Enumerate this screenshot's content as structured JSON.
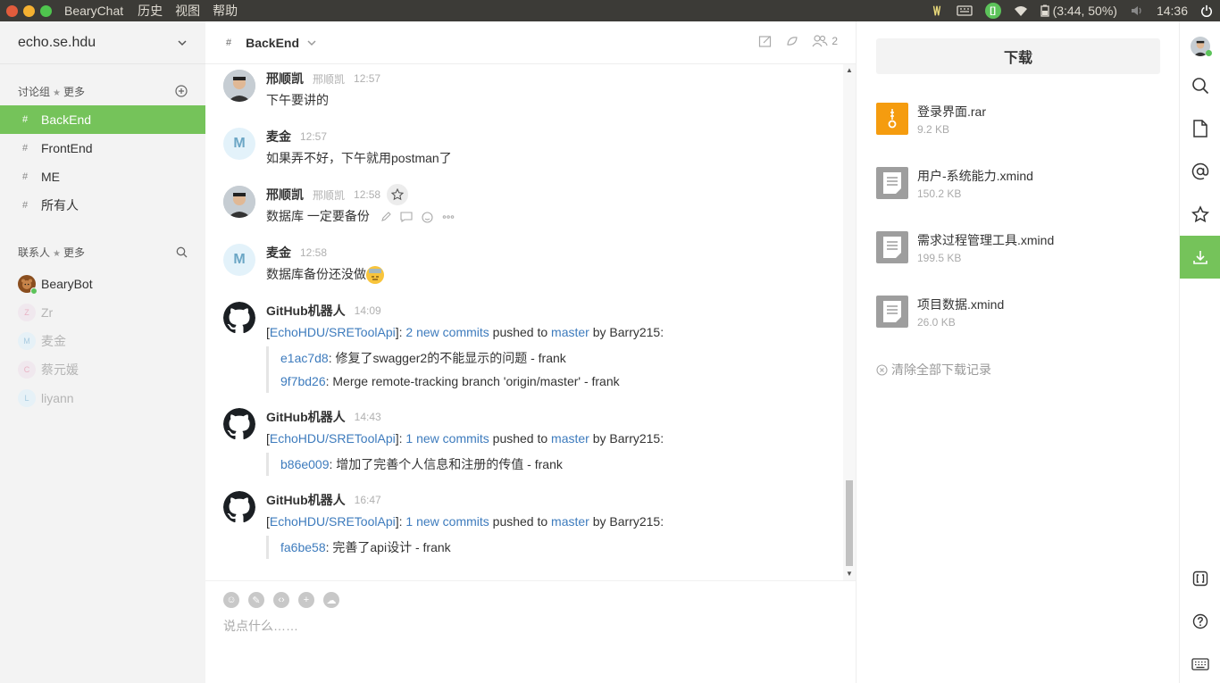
{
  "topbar": {
    "app_name": "BearyChat",
    "menu": [
      "历史",
      "视图",
      "帮助"
    ],
    "battery": "(3:44, 50%)",
    "clock": "14:36"
  },
  "sidebar": {
    "team_name": "echo.se.hdu",
    "channels_heading": "讨论组",
    "channels_more": "更多",
    "channels": [
      {
        "name": "BackEnd",
        "active": true
      },
      {
        "name": "FrontEnd",
        "active": false
      },
      {
        "name": "ME",
        "active": false
      },
      {
        "name": "所有人",
        "active": false
      }
    ],
    "contacts_heading": "联系人",
    "contacts_more": "更多",
    "contacts": [
      {
        "name": "BearyBot",
        "initial": "",
        "online": true
      },
      {
        "name": "Zr",
        "initial": "Z",
        "online": false
      },
      {
        "name": "麦金",
        "initial": "M",
        "online": false
      },
      {
        "name": "蔡元媛",
        "initial": "C",
        "online": false
      },
      {
        "name": "liyann",
        "initial": "L",
        "online": false
      }
    ]
  },
  "chat": {
    "channel_name": "BackEnd",
    "member_count": "2",
    "messages": [
      {
        "name": "邢顺凯",
        "alias": "邢顺凯",
        "time": "12:57",
        "text": "下午要讲的"
      },
      {
        "name": "麦金",
        "time": "12:57",
        "text": "如果弄不好，下午就用postman了"
      },
      {
        "name": "邢顺凯",
        "alias": "邢顺凯",
        "time": "12:58",
        "text": "数据库 一定要备份"
      },
      {
        "name": "麦金",
        "time": "12:58",
        "text": "数据库备份还没做"
      },
      {
        "name": "GitHub机器人",
        "time": "14:09",
        "repo": "EchoHDU/SREToolApi",
        "commits": "2 new commits",
        "pushed": " pushed to ",
        "branch": "master",
        "by": " by Barry215:",
        "items": [
          {
            "sha": "e1ac7d8",
            "msg": ": 修复了swagger2的不能显示的问题 - frank"
          },
          {
            "sha": "9f7bd26",
            "msg": ": Merge remote-tracking branch 'origin/master' - frank"
          }
        ]
      },
      {
        "name": "GitHub机器人",
        "time": "14:43",
        "repo": "EchoHDU/SREToolApi",
        "commits": "1 new commits",
        "pushed": " pushed to ",
        "branch": "master",
        "by": " by Barry215:",
        "items": [
          {
            "sha": "b86e009",
            "msg": ": 增加了完善个人信息和注册的传值 - frank"
          }
        ]
      },
      {
        "name": "GitHub机器人",
        "time": "16:47",
        "repo": "EchoHDU/SREToolApi",
        "commits": "1 new commits",
        "pushed": " pushed to ",
        "branch": "master",
        "by": " by Barry215:",
        "items": [
          {
            "sha": "fa6be58",
            "msg": ": 完善了api设计 - frank"
          }
        ]
      }
    ],
    "composer_placeholder": "说点什么……"
  },
  "downloads": {
    "title": "下载",
    "files": [
      {
        "name": "登录界面.rar",
        "size": "9.2 KB",
        "type": "zip"
      },
      {
        "name": "用户-系统能力.xmind",
        "size": "150.2 KB",
        "type": "doc"
      },
      {
        "name": "需求过程管理工具.xmind",
        "size": "199.5 KB",
        "type": "doc"
      },
      {
        "name": "项目数据.xmind",
        "size": "26.0 KB",
        "type": "doc"
      }
    ],
    "clear_label": "清除全部下载记录"
  },
  "colors": {
    "accent": "#75c35a",
    "link": "#3d7bbd",
    "zip": "#f59c0f"
  }
}
